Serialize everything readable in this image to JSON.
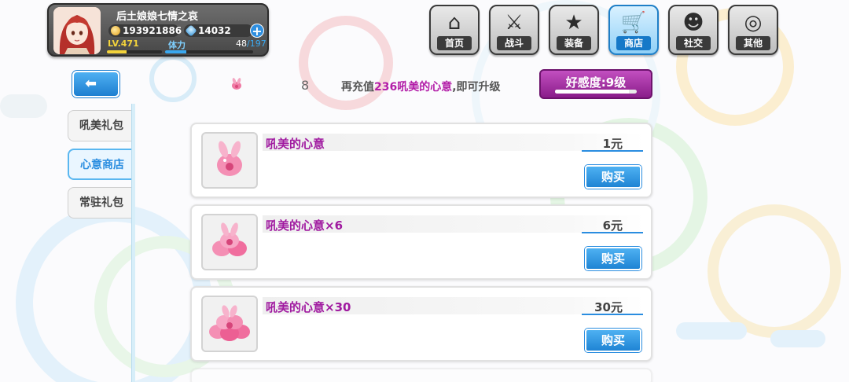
{
  "player": {
    "name": "后土娘娘七情之哀",
    "gold": "193921886",
    "gems": "14032",
    "level": "LV.471",
    "level_progress": 0.35,
    "stamina_label": "体力",
    "stamina_current": "48",
    "stamina_max": "/197",
    "stamina_progress": 0.24
  },
  "nav": {
    "items": [
      {
        "label": "首页",
        "icon": "home-icon"
      },
      {
        "label": "战斗",
        "icon": "battle-icon"
      },
      {
        "label": "装备",
        "icon": "equipment-icon"
      },
      {
        "label": "商店",
        "icon": "shop-icon",
        "active": true
      },
      {
        "label": "社交",
        "icon": "social-icon"
      },
      {
        "label": "其他",
        "icon": "other-icon"
      }
    ]
  },
  "affection": {
    "heart_count": "8",
    "msg_prefix": "再充值",
    "msg_highlight": "236吼美的心意",
    "msg_suffix": ",即可升级",
    "level_label": "好感度:9级",
    "progress": 0.9
  },
  "side_tabs": [
    {
      "label": "吼美礼包",
      "active": false
    },
    {
      "label": "心意商店",
      "active": true
    },
    {
      "label": "常驻礼包",
      "active": false
    }
  ],
  "products": [
    {
      "name": "吼美的心意",
      "price": "1元",
      "buy_label": "购买"
    },
    {
      "name": "吼美的心意×6",
      "price": "6元",
      "buy_label": "购买"
    },
    {
      "name": "吼美的心意×30",
      "price": "30元",
      "buy_label": "购买"
    }
  ],
  "colors": {
    "accent_blue": "#2a8de0",
    "affection_purple": "#a01aa0",
    "gold": "#f3d33b"
  }
}
